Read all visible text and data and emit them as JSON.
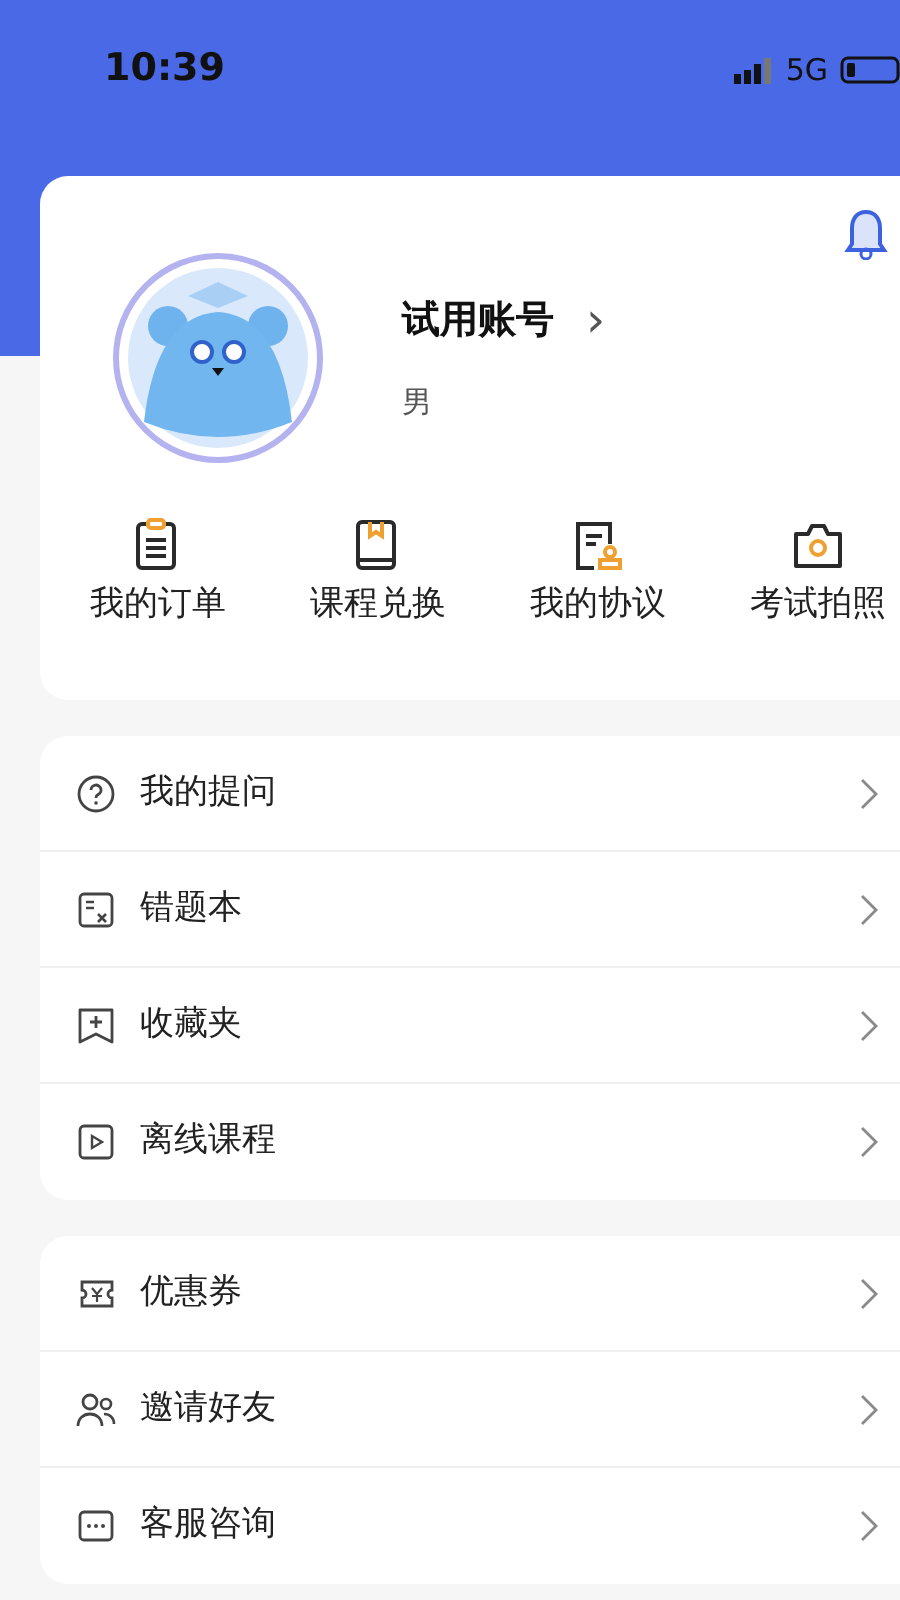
{
  "status_bar": {
    "time": "10:39",
    "network": "5G"
  },
  "profile": {
    "name": "试用账号",
    "chevron": "›",
    "gender": "男"
  },
  "shortcuts": [
    {
      "kind": "order",
      "label": "我的订单"
    },
    {
      "kind": "book",
      "label": "课程兑换"
    },
    {
      "kind": "contract",
      "label": "我的协议"
    },
    {
      "kind": "camera",
      "label": "考试拍照"
    }
  ],
  "menu_groups": [
    [
      {
        "kind": "question",
        "label": "我的提问"
      },
      {
        "kind": "mistakes",
        "label": "错题本"
      },
      {
        "kind": "favorite",
        "label": "收藏夹"
      },
      {
        "kind": "video",
        "label": "离线课程"
      }
    ],
    [
      {
        "kind": "coupon",
        "label": "优惠券"
      },
      {
        "kind": "invite",
        "label": "邀请好友"
      },
      {
        "kind": "service",
        "label": "客服咨询"
      }
    ]
  ]
}
